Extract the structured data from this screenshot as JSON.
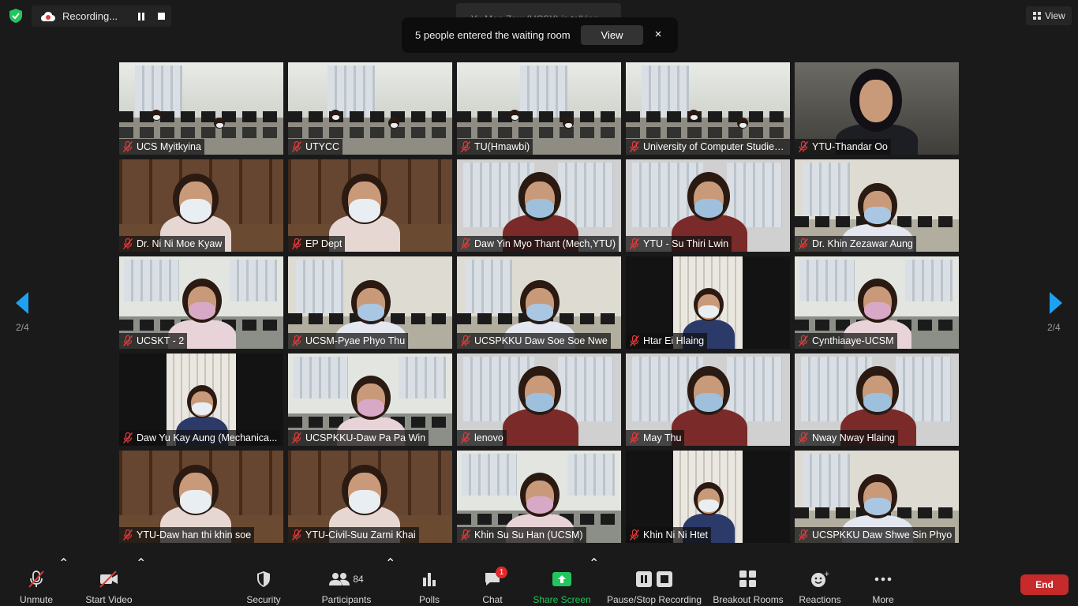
{
  "top": {
    "recording_label": "Recording...",
    "talking_text": "Yu Mon Zaw (UCSY) is talking...",
    "waiting_text": "5 people entered the waiting room",
    "waiting_view_label": "View",
    "waiting_close_label": "×",
    "view_label": "View"
  },
  "navigation": {
    "page_left": "2/4",
    "page_right": "2/4"
  },
  "participants": [
    {
      "name": "UCS Myitkyina",
      "muted": true,
      "scene": "class"
    },
    {
      "name": "UTYCC",
      "muted": true,
      "scene": "class"
    },
    {
      "name": "TU(Hmawbi)",
      "muted": true,
      "scene": "class"
    },
    {
      "name": "University of Computer Studies...",
      "muted": true,
      "scene": "class"
    },
    {
      "name": "YTU-Thandar Oo",
      "muted": true,
      "scene": "face"
    },
    {
      "name": "Dr. Ni Ni Moe Kyaw",
      "muted": true,
      "scene": "shelf"
    },
    {
      "name": "EP Dept",
      "muted": true,
      "scene": "shelf"
    },
    {
      "name": "Daw Yin Myo Thant (Mech,YTU)",
      "muted": true,
      "scene": "window"
    },
    {
      "name": "YTU - Su Thiri Lwin",
      "muted": true,
      "scene": "window"
    },
    {
      "name": "Dr. Khin Zezawar Aung",
      "muted": true,
      "scene": "office"
    },
    {
      "name": "UCSKT - 2",
      "muted": true,
      "scene": "lab"
    },
    {
      "name": "UCSM-Pyae Phyo Thu",
      "muted": true,
      "scene": "office"
    },
    {
      "name": "UCSPKKU Daw Soe Soe Nwe",
      "muted": true,
      "scene": "office"
    },
    {
      "name": "Htar Ei Hlaing",
      "muted": true,
      "scene": "narrow"
    },
    {
      "name": "Cynthiaaye-UCSM",
      "muted": true,
      "scene": "lab"
    },
    {
      "name": "Daw Yu Kay Aung (Mechanica...",
      "muted": true,
      "scene": "narrow"
    },
    {
      "name": "UCSPKKU-Daw Pa Pa Win",
      "muted": true,
      "scene": "lab"
    },
    {
      "name": "lenovo",
      "muted": true,
      "scene": "window"
    },
    {
      "name": "May Thu",
      "muted": true,
      "scene": "window"
    },
    {
      "name": "Nway Nway Hlaing",
      "muted": true,
      "scene": "window"
    },
    {
      "name": "YTU-Daw han thi khin soe",
      "muted": true,
      "scene": "shelf"
    },
    {
      "name": "YTU-Civil-Suu Zarni Khai",
      "muted": true,
      "scene": "shelf"
    },
    {
      "name": "Khin Su Su Han (UCSM)",
      "muted": true,
      "scene": "lab"
    },
    {
      "name": "Khin Ni Ni Htet",
      "muted": true,
      "scene": "narrow"
    },
    {
      "name": "UCSPKKU Daw Shwe Sin Phyo",
      "muted": true,
      "scene": "office"
    }
  ],
  "toolbar": {
    "unmute": "Unmute",
    "start_video": "Start Video",
    "security": "Security",
    "participants": "Participants",
    "participants_count": "84",
    "polls": "Polls",
    "chat": "Chat",
    "chat_badge": "1",
    "share_screen": "Share Screen",
    "pause_stop_recording": "Pause/Stop Recording",
    "breakout_rooms": "Breakout Rooms",
    "reactions": "Reactions",
    "more": "More",
    "end": "End"
  },
  "colors": {
    "background": "#1a1a1a",
    "share_green": "#23c55e",
    "end_red": "#c62a2a",
    "nav_blue": "#1ea1f2",
    "muted_red": "#e03a3a"
  }
}
